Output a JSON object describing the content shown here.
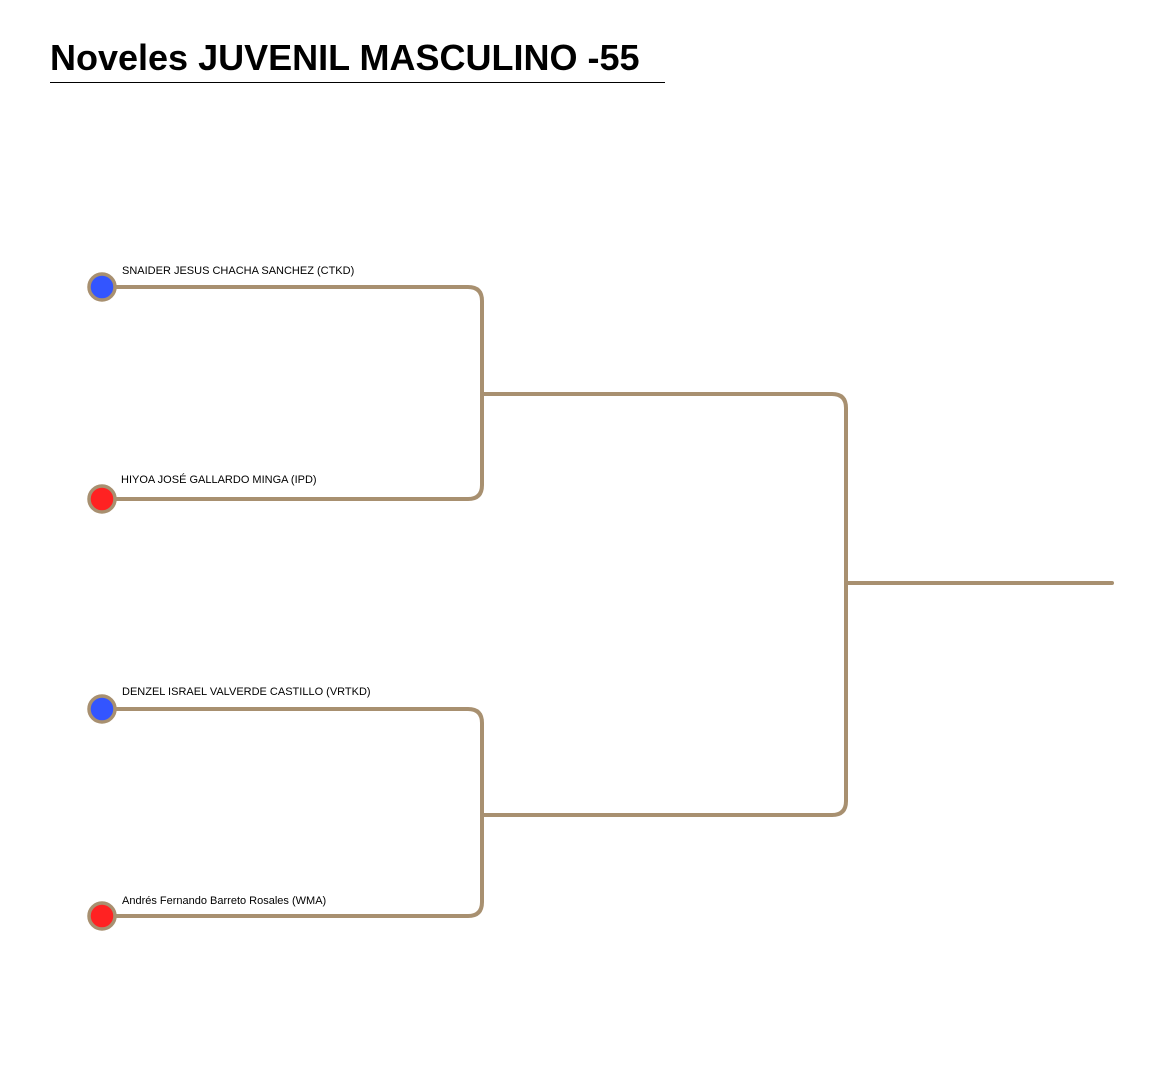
{
  "title": "Noveles JUVENIL MASCULINO -55",
  "colors": {
    "line": "#a89070",
    "blue": "#3355ff",
    "red": "#ff2222"
  },
  "competitors": [
    {
      "name": "SNAIDER JESUS CHACHA SANCHEZ (CTKD)",
      "corner": "blue"
    },
    {
      "name": "HIYOA JOSÉ GALLARDO MINGA (IPD)",
      "corner": "red"
    },
    {
      "name": "DENZEL ISRAEL VALVERDE CASTILLO (VRTKD)",
      "corner": "blue"
    },
    {
      "name": "Andrés Fernando Barreto Rosales (WMA)",
      "corner": "red"
    }
  ]
}
